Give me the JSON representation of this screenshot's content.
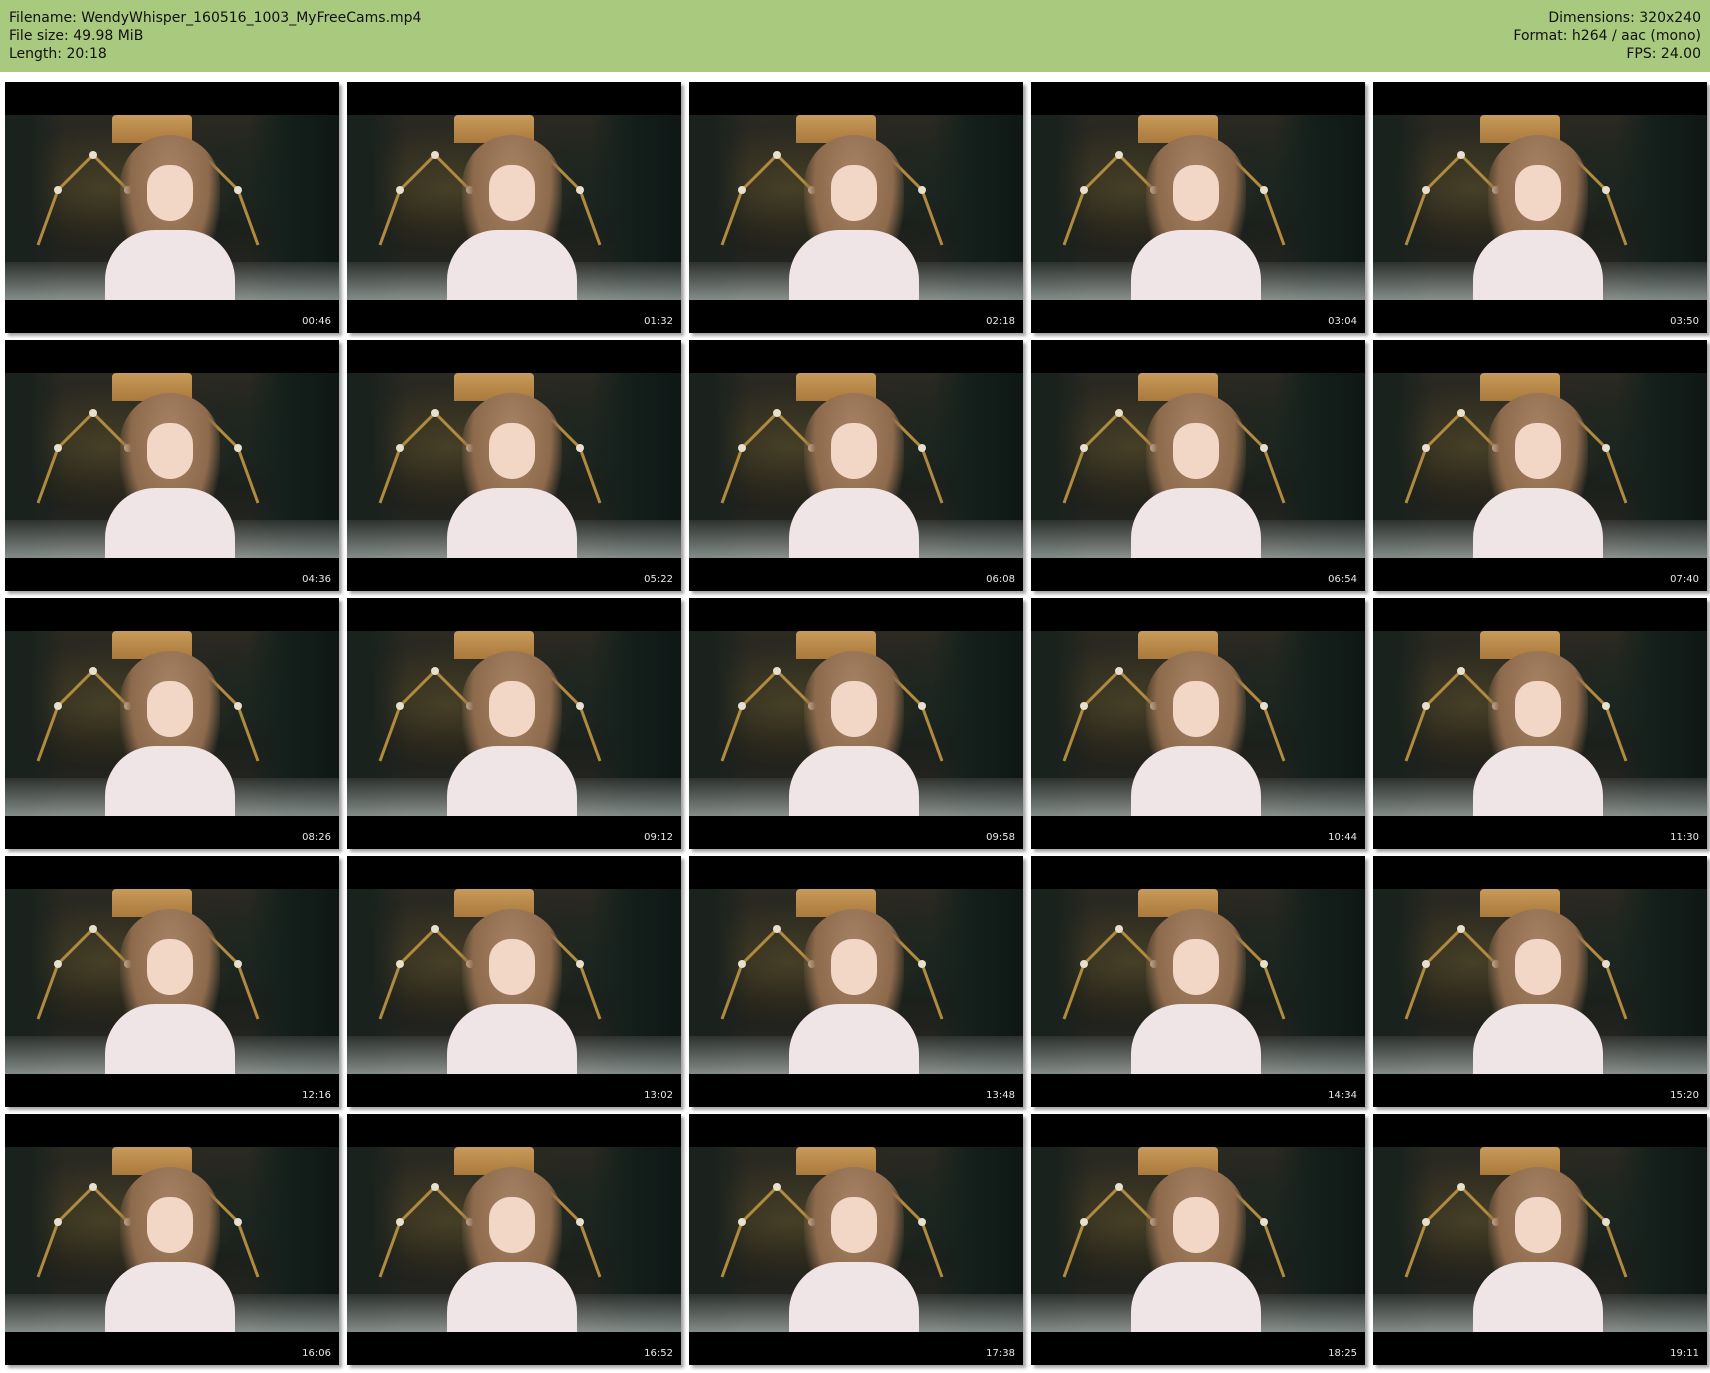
{
  "header": {
    "filename_line": "Filename: WendyWhisper_160516_1003_MyFreeCams.mp4",
    "filesize_line": "File size: 49.98 MiB",
    "length_line": "Length: 20:18",
    "dimensions_line": "Dimensions: 320x240",
    "format_line": "Format: h264 / aac (mono)",
    "fps_line": "FPS: 24.00"
  },
  "colors": {
    "header_bg": "#a9c97e",
    "page_bg": "#ffffff",
    "thumb_bg": "#000000"
  },
  "thumbnails": [
    {
      "timestamp": "00:46"
    },
    {
      "timestamp": "01:32"
    },
    {
      "timestamp": "02:18"
    },
    {
      "timestamp": "03:04"
    },
    {
      "timestamp": "03:50"
    },
    {
      "timestamp": "04:36"
    },
    {
      "timestamp": "05:22"
    },
    {
      "timestamp": "06:08"
    },
    {
      "timestamp": "06:54"
    },
    {
      "timestamp": "07:40"
    },
    {
      "timestamp": "08:26"
    },
    {
      "timestamp": "09:12"
    },
    {
      "timestamp": "09:58"
    },
    {
      "timestamp": "10:44"
    },
    {
      "timestamp": "11:30"
    },
    {
      "timestamp": "12:16"
    },
    {
      "timestamp": "13:02"
    },
    {
      "timestamp": "13:48"
    },
    {
      "timestamp": "14:34"
    },
    {
      "timestamp": "15:20"
    },
    {
      "timestamp": "16:06"
    },
    {
      "timestamp": "16:52"
    },
    {
      "timestamp": "17:38"
    },
    {
      "timestamp": "18:25"
    },
    {
      "timestamp": "19:11"
    }
  ]
}
